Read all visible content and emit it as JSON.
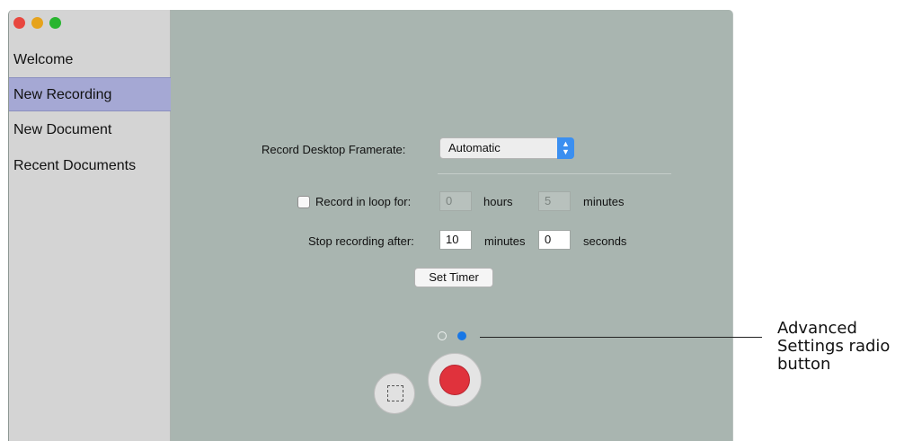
{
  "window": {
    "traffic_lights": [
      "close",
      "minimize",
      "zoom"
    ]
  },
  "sidebar": {
    "items": [
      {
        "label": "Welcome"
      },
      {
        "label": "New Recording",
        "selected": true
      },
      {
        "label": "New Document"
      },
      {
        "label": "Recent Documents"
      }
    ]
  },
  "main": {
    "framerate_label": "Record Desktop Framerate:",
    "framerate_value": "Automatic",
    "loop_checkbox_label": "Record in loop for:",
    "loop_checked": false,
    "loop_hours": "0",
    "hours_label": "hours",
    "loop_minutes": "5",
    "minutes_label": "minutes",
    "stop_label": "Stop recording after:",
    "stop_minutes": "10",
    "stop_minutes_label": "minutes",
    "stop_seconds": "0",
    "seconds_label": "seconds",
    "set_timer_label": "Set Timer",
    "page_indicator": {
      "pages": 2,
      "active": 2
    }
  },
  "controls": {
    "area_select_icon": "dashed-square-icon",
    "record_icon": "record-dot-icon"
  },
  "annotation": {
    "line1": "Advanced",
    "line2": "Settings radio",
    "line3": "button"
  },
  "colors": {
    "window_bg": "#a9b5b0",
    "sidebar_bg": "#d4d4d4",
    "selected_bg": "#a5a8d4",
    "accent": "#1877e6",
    "record_red": "#e0323c"
  }
}
